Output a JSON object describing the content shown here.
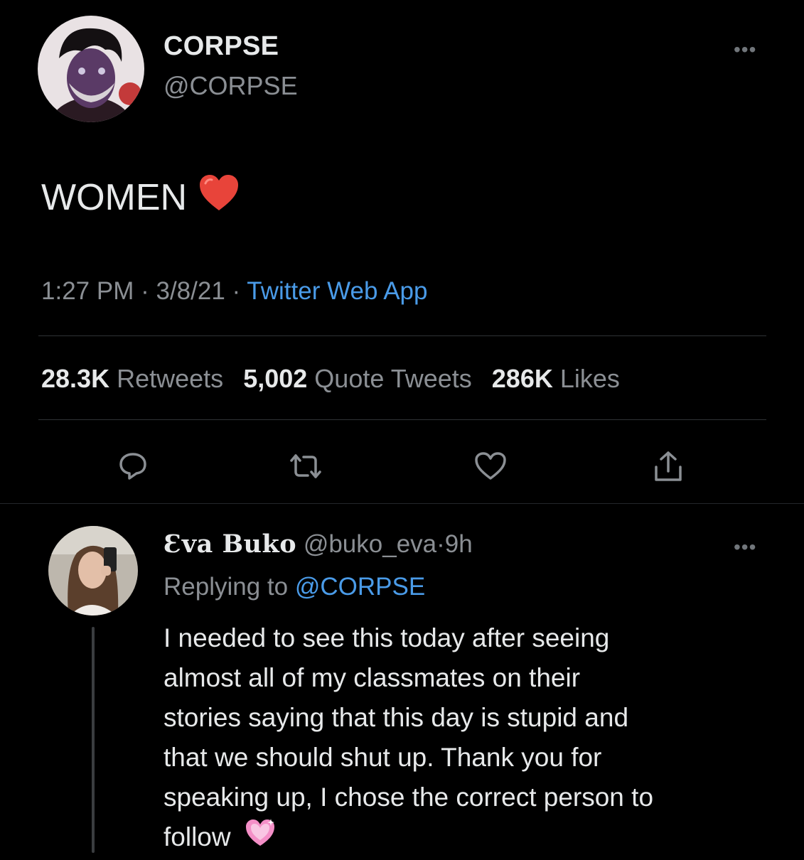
{
  "tweet": {
    "display_name": "CORPSE",
    "handle": "@CORPSE",
    "more_label": "•••",
    "text": "WOMEN",
    "emoji": "red-heart",
    "time": "1:27 PM",
    "date": "3/8/21",
    "separator": "·",
    "source": "Twitter Web App",
    "stats": {
      "retweets_count": "28.3K",
      "retweets_label": "Retweets",
      "quotes_count": "5,002",
      "quotes_label": "Quote Tweets",
      "likes_count": "286K",
      "likes_label": "Likes"
    },
    "actions": [
      "reply-icon",
      "retweet-icon",
      "like-icon",
      "share-icon"
    ]
  },
  "reply": {
    "display_name": "Ɛva Buko",
    "handle": "@buko_eva",
    "separator": "·",
    "age": "9h",
    "more_label": "•••",
    "replying_prefix": "Replying to",
    "replying_to": "@CORPSE",
    "lines": [
      "I needed to see this today after seeing",
      "almost all of my classmates on their",
      "stories saying that this day is stupid and",
      "that we should shut up. Thank you for",
      "speaking up, I chose the correct person to",
      "follow"
    ],
    "emoji": "sparkling-heart"
  },
  "colors": {
    "background": "#000000",
    "text_primary": "#e7e9ea",
    "text_secondary": "#8b8f94",
    "link": "#4a9be8",
    "divider": "#2f3336",
    "heart_red": "#e8443a",
    "heart_pink": "#f48fc7"
  }
}
